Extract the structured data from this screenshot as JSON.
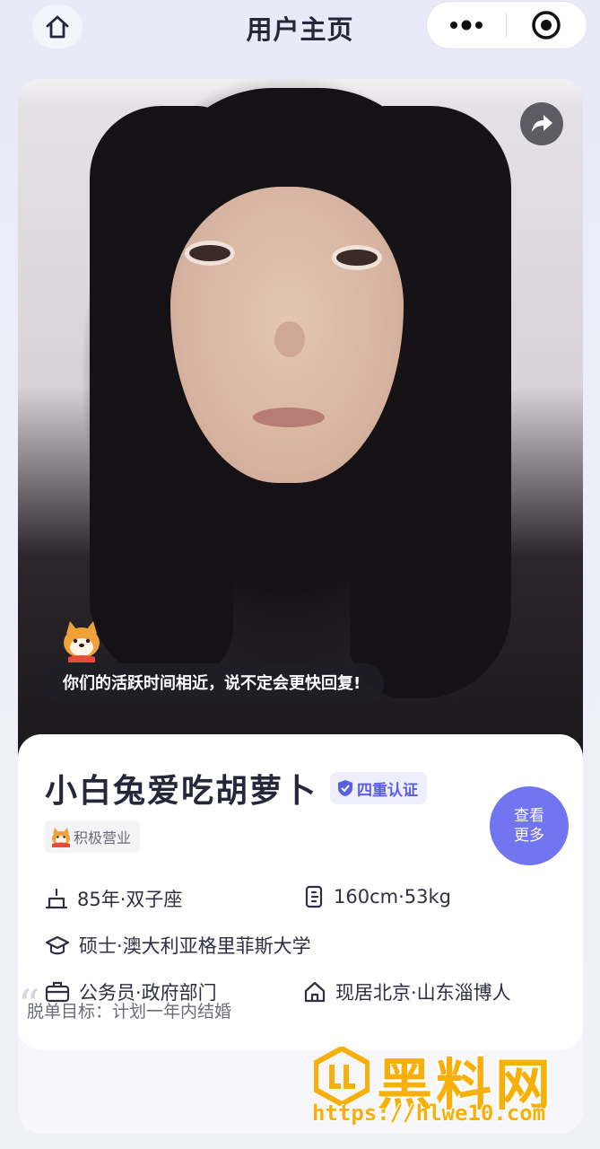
{
  "header": {
    "title": "用户主页",
    "home_icon": "home-icon",
    "more_icon": "more-dots-icon",
    "close_icon": "target-icon"
  },
  "photo": {
    "share_icon": "share-icon",
    "hint": "你们的活跃时间相近，说不定会更快回复!"
  },
  "profile": {
    "name": "小白兔爱吃胡萝卜",
    "verify_badge": "四重认证",
    "active_tag": "积极营业",
    "more_button": [
      "查看",
      "更多"
    ],
    "attributes": {
      "birth": "85年·双子座",
      "body": "160cm·53kg",
      "education": "硕士·澳大利亚格里菲斯大学",
      "job": "公务员·政府部门",
      "location": "现居北京·山东淄博人"
    },
    "goal": "脱单目标：计划一年内结婚"
  },
  "watermark": {
    "logo_text": "黑料网",
    "url": "https://hlwe10.com"
  },
  "colors": {
    "accent": "#7275f0",
    "badge_text": "#5a5ee0",
    "watermark": "#f7b00a"
  }
}
